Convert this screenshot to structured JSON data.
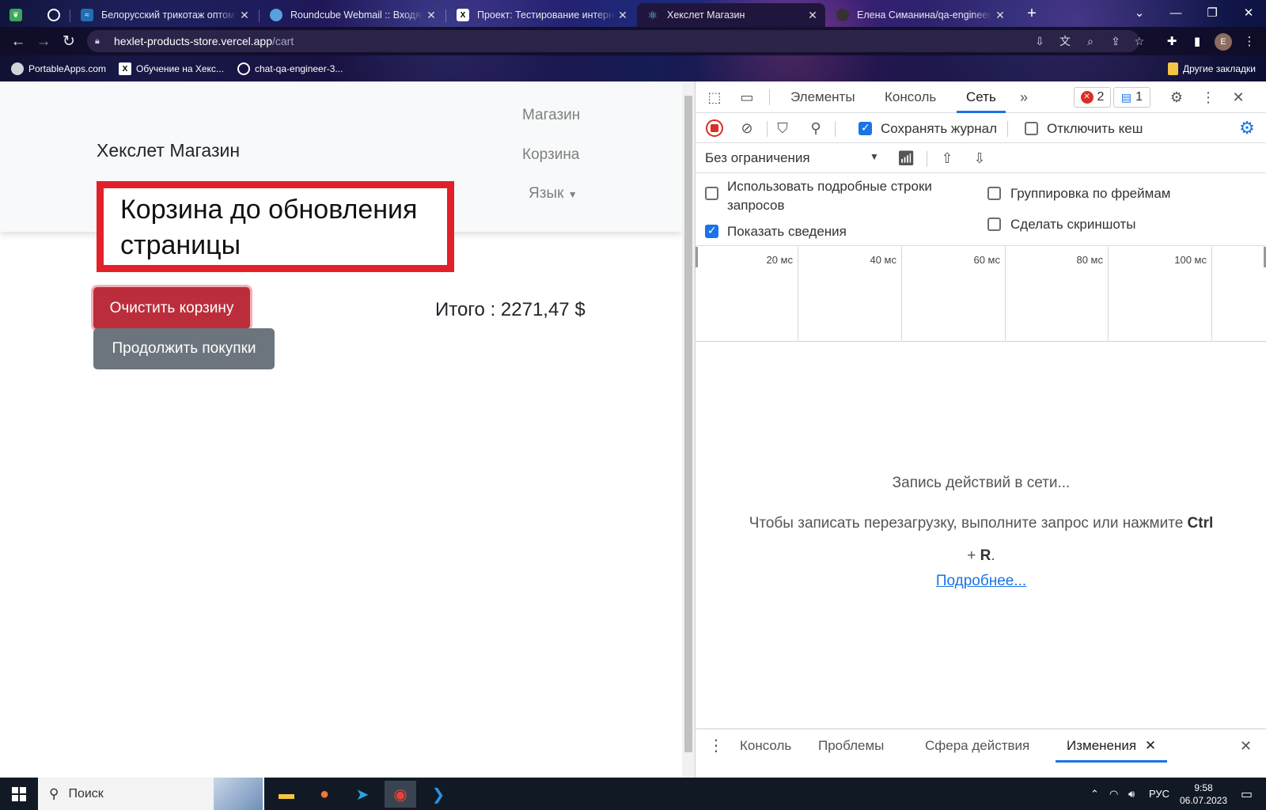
{
  "browser": {
    "tabs": [
      {
        "title": "",
        "active": false
      },
      {
        "title": "",
        "active": false
      },
      {
        "title": "Белорусский трикотаж оптом и",
        "active": false
      },
      {
        "title": "Roundcube Webmail :: Входящие",
        "active": false
      },
      {
        "title": "Проект: Тестирование интернет",
        "active": false
      },
      {
        "title": "Хекслет Магазин",
        "active": true
      },
      {
        "title": "Елена Симанина/qa-engineer-p",
        "active": false
      }
    ],
    "url_host": "hexlet-products-store.vercel.app",
    "url_path": "/cart",
    "avatar_letter": "E",
    "bookmarks": [
      "PortableApps.com",
      "Обучение на Хекс...",
      "chat-qa-engineer-3..."
    ],
    "other_bookmarks": "Другие закладки"
  },
  "page": {
    "brand": "Хекслет Магазин",
    "nav": {
      "shop": "Магазин",
      "cart": "Корзина",
      "lang": "Язык"
    },
    "annotation": "Корзина до обновления страницы",
    "clear_button": "Очистить корзину",
    "continue_button": "Продолжить покупки",
    "total": "Итого : 2271,47 $"
  },
  "devtools": {
    "tabs": [
      "Элементы",
      "Консоль",
      "Сеть"
    ],
    "active_tab": "Сеть",
    "errors_count": "2",
    "messages_count": "1",
    "preserve_log": "Сохранять журнал",
    "disable_cache": "Отключить кеш",
    "throttling": "Без ограничения",
    "options": {
      "big_rows": "Использовать подробные строки запросов",
      "show_overview": "Показать сведения",
      "group_by_frame": "Группировка по фреймам",
      "screenshots": "Сделать скриншоты"
    },
    "timeline_ticks": [
      "20 мс",
      "40 мс",
      "60 мс",
      "80 мс",
      "100 мс"
    ],
    "recording_title": "Запись действий в сети...",
    "recording_hint_1": "Чтобы записать перезагрузку, выполните запрос или нажмите ",
    "recording_hint_key1": "Ctrl",
    "recording_hint_2": "+ ",
    "recording_hint_key2": "R",
    "recording_hint_3": ".",
    "learn_more": "Подробнее...",
    "drawer_tabs": [
      "Консоль",
      "Проблемы",
      "Сфера действия",
      "Изменения"
    ]
  },
  "taskbar": {
    "search_placeholder": "Поиск",
    "language": "РУС",
    "time": "9:58",
    "date": "06.07.2023"
  },
  "colors": {
    "danger": "#bb2d3b",
    "secondary": "#6c757d",
    "annotation_border": "#e2202a",
    "devtools_accent": "#1a73e8",
    "record_red": "#d93025"
  }
}
